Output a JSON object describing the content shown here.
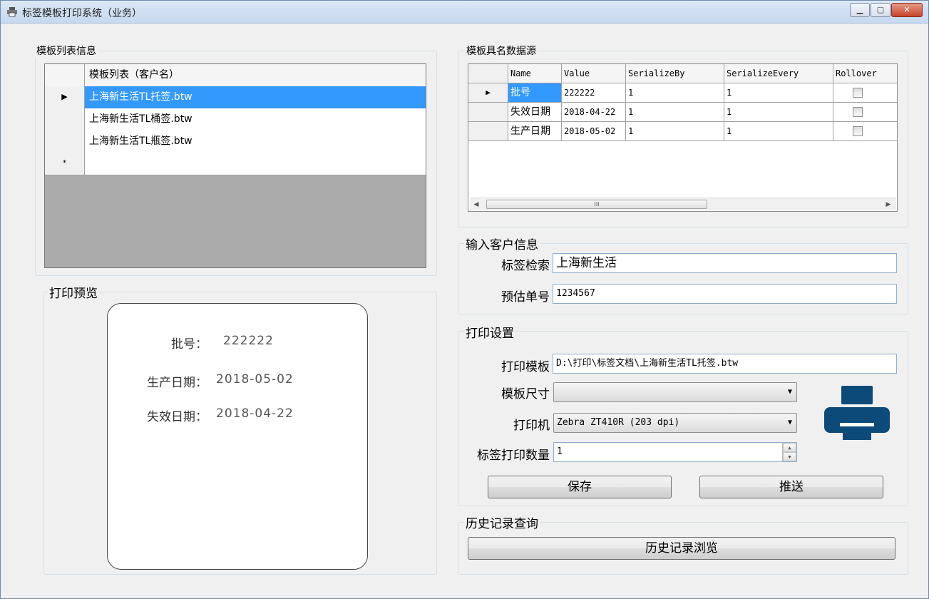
{
  "window": {
    "title": "标签模板打印系统（业务）",
    "controls": {
      "minimize": "▁",
      "maximize": "▢",
      "close": "✕"
    }
  },
  "template_list": {
    "group_title": "模板列表信息",
    "column_header": "模板列表（客户名）",
    "rows": [
      {
        "marker": "▶",
        "name": "上海新生活TL托签.btw"
      },
      {
        "marker": "",
        "name": "上海新生活TL桶签.btw"
      },
      {
        "marker": "",
        "name": "上海新生活TL瓶签.btw"
      },
      {
        "marker": "*",
        "name": ""
      }
    ]
  },
  "datasource": {
    "group_title": "模板具名数据源",
    "columns": [
      "Name",
      "Value",
      "SerializeBy",
      "SerializeEvery",
      "Rollover"
    ],
    "rows": [
      {
        "marker": "▶",
        "name": "批号",
        "value": "222222",
        "serialize_by": "1",
        "serialize_every": "1",
        "rollover": false
      },
      {
        "marker": "",
        "name": "失效日期",
        "value": "2018-04-22",
        "serialize_by": "1",
        "serialize_every": "1",
        "rollover": false
      },
      {
        "marker": "",
        "name": "生产日期",
        "value": "2018-05-02",
        "serialize_by": "1",
        "serialize_every": "1",
        "rollover": false
      }
    ],
    "scrollbar": {
      "left_arrow": "◀",
      "right_arrow": "▶",
      "thumb_grip": "III"
    }
  },
  "preview": {
    "group_title": "打印预览",
    "fields": [
      {
        "label": "批号：",
        "value": "222222"
      },
      {
        "label": "生产日期：",
        "value": "2018-05-02"
      },
      {
        "label": "失效日期：",
        "value": "2018-04-22"
      }
    ]
  },
  "customer": {
    "group_title": "输入客户信息",
    "search_label": "标签检索",
    "search_value": "上海新生活",
    "order_label": "预估单号",
    "order_value": "1234567"
  },
  "print_settings": {
    "group_title": "打印设置",
    "template_label": "打印模板",
    "template_value": "D:\\打印\\标签文档\\上海新生活TL托签.btw",
    "size_label": "模板尺寸",
    "size_value": "",
    "printer_label": "打印机",
    "printer_value": "Zebra ZT410R (203 dpi)",
    "quantity_label": "标签打印数量",
    "quantity_value": "1",
    "spin_up": "▲",
    "spin_down": "▼",
    "dropdown_caret": "▼",
    "save_button": "保存",
    "push_button": "推送",
    "printer_icon": "printer-icon",
    "printer_icon_color": "#0c4a7a"
  },
  "history": {
    "group_title": "历史记录查询",
    "browse_button": "历史记录浏览"
  }
}
